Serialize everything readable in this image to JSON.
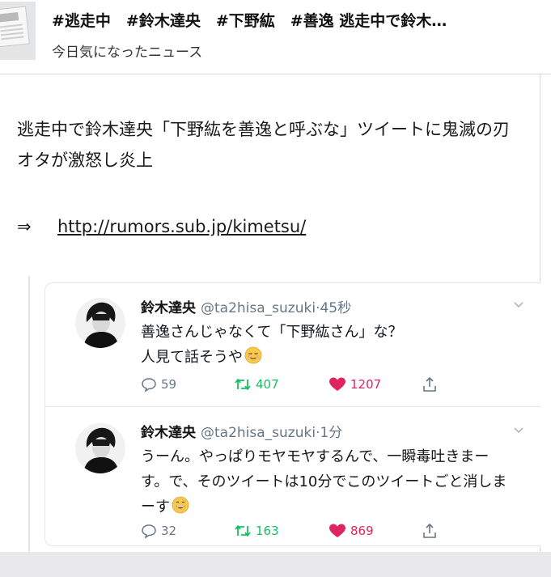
{
  "header": {
    "title": "#逃走中　#鈴木達央　#下野紘　#善逸 逃走中で鈴木…",
    "subtitle": "今日気になったニュース",
    "icon": "newspaper-icon"
  },
  "post": {
    "text": "逃走中で鈴木達央「下野紘を善逸と呼ぶな」ツイートに鬼滅の刃オタが激怒し炎上",
    "arrow": "⇒",
    "link": "http://rumors.sub.jp/kimetsu/"
  },
  "tweets": [
    {
      "name": "鈴木達央",
      "handle": "@ta2hisa_suzuki·45秒",
      "text": "善逸さんじゃなくて「下野紘さん」な？\n人見て話そうや",
      "emoji": "relieved-face",
      "replies": "59",
      "retweets": "407",
      "likes": "1207"
    },
    {
      "name": "鈴木達央",
      "handle": "@ta2hisa_suzuki·1分",
      "text": "うーん。やっぱりモヤモヤするんで、一瞬毒吐きまーす。で、そのツイートは10分でこのツイートごと消しまーす",
      "emoji": "grinning-face",
      "replies": "32",
      "retweets": "163",
      "likes": "869"
    }
  ],
  "colors": {
    "retweet": "#17bf63",
    "like": "#e0245e",
    "muted": "#657786",
    "divider": "#e1e8ed"
  }
}
